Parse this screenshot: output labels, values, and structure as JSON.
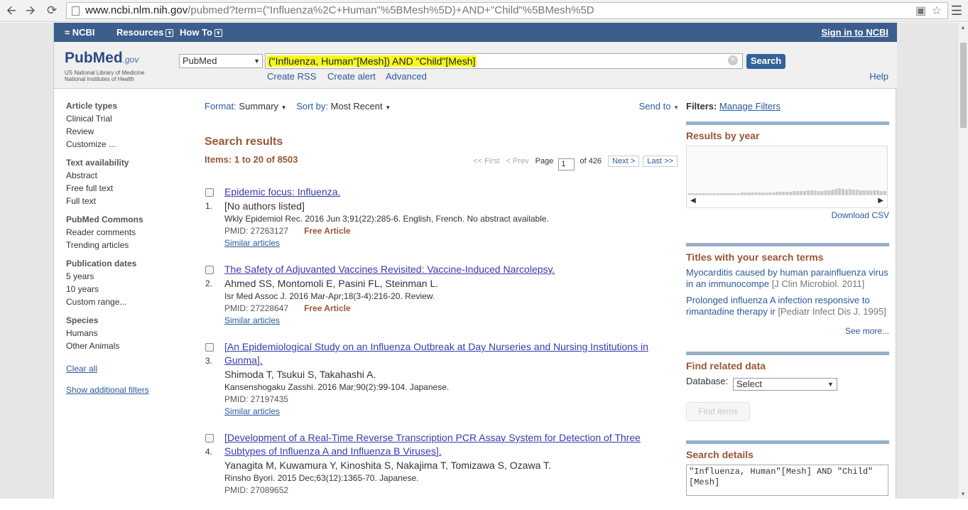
{
  "browser": {
    "url_host": "www.ncbi.nlm.nih.gov",
    "url_path": "/pubmed?term=(\"Influenza%2C+Human\"%5BMesh%5D)+AND+\"Child\"%5BMesh%5D"
  },
  "ncbi": {
    "brand": "NCBI",
    "resources": "Resources",
    "howto": "How To",
    "signin": "Sign in to NCBI"
  },
  "header": {
    "logo_pub": "Pub",
    "logo_med": "Med",
    "logo_gov": ".gov",
    "logo_sub1": "US National Library of Medicine",
    "logo_sub2": "National Institutes of Health",
    "db_value": "PubMed",
    "search_term": "(\"Influenza, Human\"[Mesh]) AND \"Child\"[Mesh]",
    "search_button": "Search",
    "create_rss": "Create RSS",
    "create_alert": "Create alert",
    "advanced": "Advanced",
    "help": "Help"
  },
  "left": {
    "groups": [
      {
        "title": "Article types",
        "items": [
          "Clinical Trial",
          "Review",
          "Customize ..."
        ]
      },
      {
        "title": "Text availability",
        "items": [
          "Abstract",
          "Free full text",
          "Full text"
        ]
      },
      {
        "title": "PubMed Commons",
        "items": [
          "Reader comments",
          "Trending articles"
        ]
      },
      {
        "title": "Publication dates",
        "items": [
          "5 years",
          "10 years",
          "Custom range..."
        ]
      },
      {
        "title": "Species",
        "items": [
          "Humans",
          "Other Animals"
        ]
      }
    ],
    "clear_all": "Clear all",
    "show_filters": "Show additional filters"
  },
  "toolbar": {
    "format_label": "Format:",
    "format_value": "Summary",
    "sort_label": "Sort by:",
    "sort_value": "Most Recent",
    "send_to": "Send to"
  },
  "results": {
    "title": "Search results",
    "items_label": "Items: 1 to 20 of 8503",
    "pager": {
      "first": "<< First",
      "prev": "< Prev",
      "page_label": "Page",
      "page_value": "1",
      "of": "of 426",
      "next": "Next >",
      "last": "Last >>"
    },
    "list": [
      {
        "num": "1.",
        "title": "Epidemic focus: Influenza.",
        "authors": "[No authors listed]",
        "journal": "Wkly Epidemiol Rec. 2016 Jun 3;91(22):285-6. English, French. No abstract available.",
        "pmid": "PMID: 27263127",
        "free": "Free Article",
        "similar": "Similar articles"
      },
      {
        "num": "2.",
        "title": "The Safety of Adjuvanted Vaccines Revisited: Vaccine-Induced Narcolepsy.",
        "authors": "Ahmed SS, Montomoli E, Pasini FL, Steinman L.",
        "journal": "Isr Med Assoc J. 2016 Mar-Apr;18(3-4):216-20. Review.",
        "pmid": "PMID: 27228647",
        "free": "Free Article",
        "similar": "Similar articles"
      },
      {
        "num": "3.",
        "title": "[An Epidemiological Study on an Influenza Outbreak at Day Nurseries and Nursing Institutions in Gunma].",
        "authors": "Shimoda T, Tsukui S, Takahashi A.",
        "journal": "Kansenshogaku Zasshi. 2016 Mar;90(2):99-104. Japanese.",
        "pmid": "PMID: 27197435",
        "free": "",
        "similar": "Similar articles"
      },
      {
        "num": "4.",
        "title": "[Development of a Real-Time Reverse Transcription PCR Assay System for Detection of Three Subtypes of Influenza A and Influenza B Viruses].",
        "authors": "Yanagita M, Kuwamura Y, Kinoshita S, Nakajima T, Tomizawa S, Ozawa T.",
        "journal": "Rinsho Byori. 2015 Dec;63(12):1365-70. Japanese.",
        "pmid": "PMID: 27089652",
        "free": "",
        "similar": ""
      }
    ]
  },
  "right": {
    "filters_label": "Filters:",
    "manage_filters": "Manage Filters",
    "results_by_year": "Results by year",
    "download_csv": "Download CSV",
    "titles_head": "Titles with your search terms",
    "titles": [
      {
        "text": "Myocarditis caused by human parainfluenza virus in an immunocompe",
        "journal": "[J Clin Microbiol. 2011]"
      },
      {
        "text": "Prolonged influenza A infection responsive to rimantadine therapy ir",
        "journal": "[Pediatr Infect Dis J. 1995]"
      }
    ],
    "see_more": "See more...",
    "find_related": "Find related data",
    "database_label": "Database:",
    "database_value": "Select",
    "find_items": "Find items",
    "search_details": "Search details",
    "search_details_text": "\"Influenza, Human\"[Mesh] AND \"Child\"[Mesh]"
  }
}
